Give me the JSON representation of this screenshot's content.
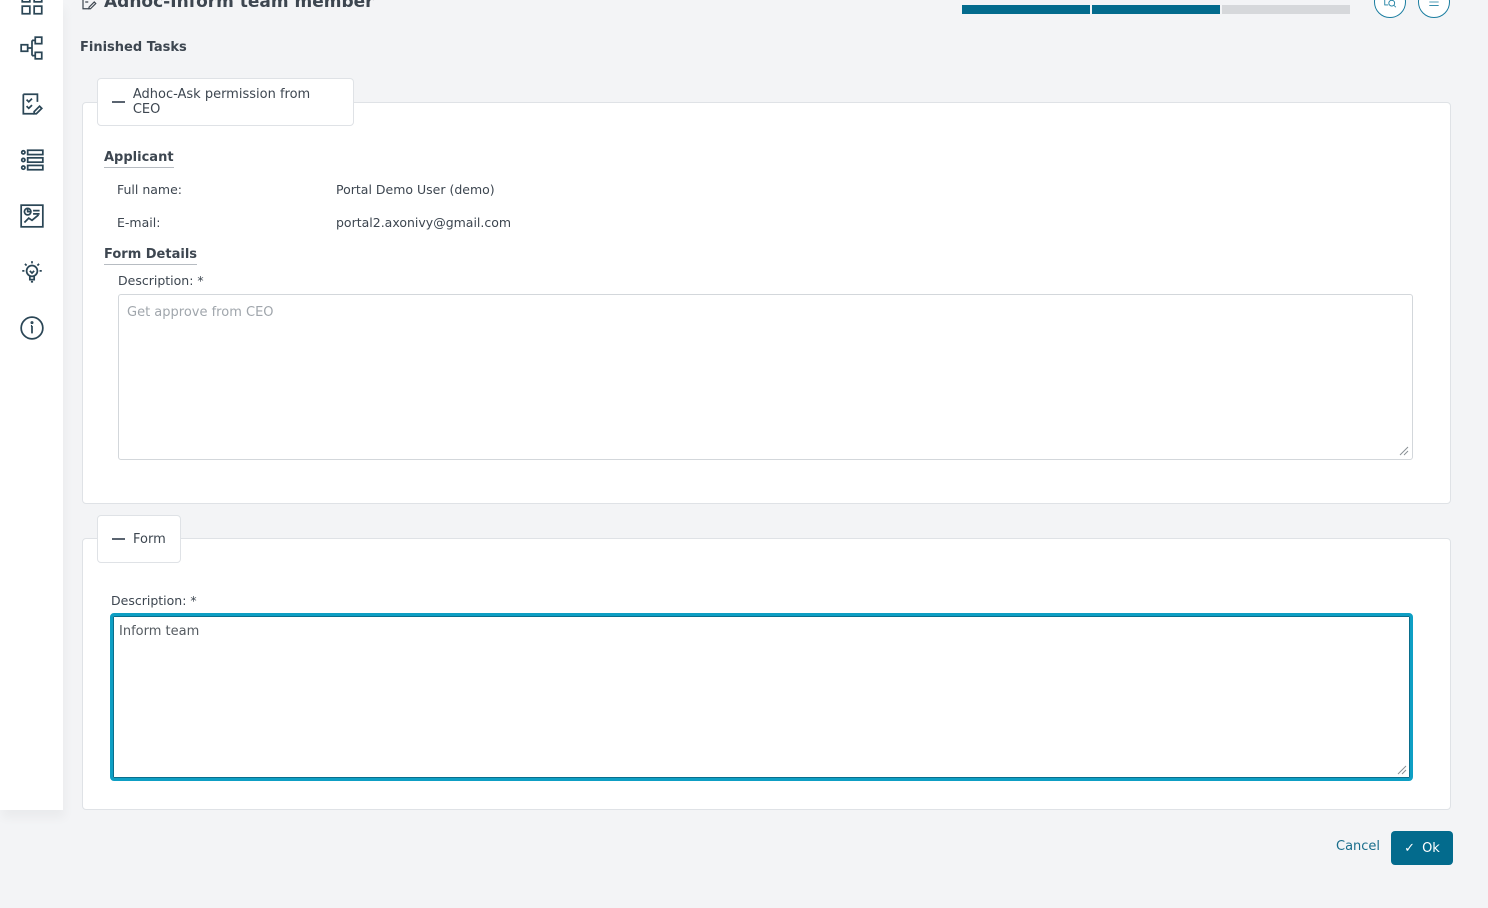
{
  "header": {
    "title": "Adhoc-Inform team member",
    "progress_steps": [
      {
        "state": "done"
      },
      {
        "state": "done"
      },
      {
        "state": "pending"
      }
    ],
    "buttons": [
      {
        "icon": "case-details-icon"
      },
      {
        "icon": "menu-icon"
      }
    ]
  },
  "sidebar": {
    "items": [
      {
        "icon": "dashboard-icon"
      },
      {
        "icon": "process-icon"
      },
      {
        "icon": "tasks-icon"
      },
      {
        "icon": "cases-icon"
      },
      {
        "icon": "statistics-icon"
      },
      {
        "icon": "lightbulb-icon"
      },
      {
        "icon": "info-icon"
      }
    ]
  },
  "finished_tasks": {
    "heading": "Finished Tasks",
    "task_tab_label": "Adhoc-Ask permission from CEO",
    "applicant": {
      "title": "Applicant",
      "full_name_label": "Full name:",
      "full_name_value": "Portal Demo User (demo)",
      "email_label": "E-mail:",
      "email_value": "portal2.axonivy@gmail.com"
    },
    "form_details": {
      "title": "Form Details",
      "description_label": "Description:",
      "required_mark": "*",
      "description_value": "Get approve from CEO"
    }
  },
  "form": {
    "tab_label": "Form",
    "description_label": "Description:",
    "required_mark": "*",
    "description_value": "Inform team"
  },
  "actions": {
    "cancel_label": "Cancel",
    "ok_label": "Ok",
    "ok_check": "✓"
  },
  "colors": {
    "accent": "#036b8d",
    "focus_border": "#0e9fc4"
  }
}
